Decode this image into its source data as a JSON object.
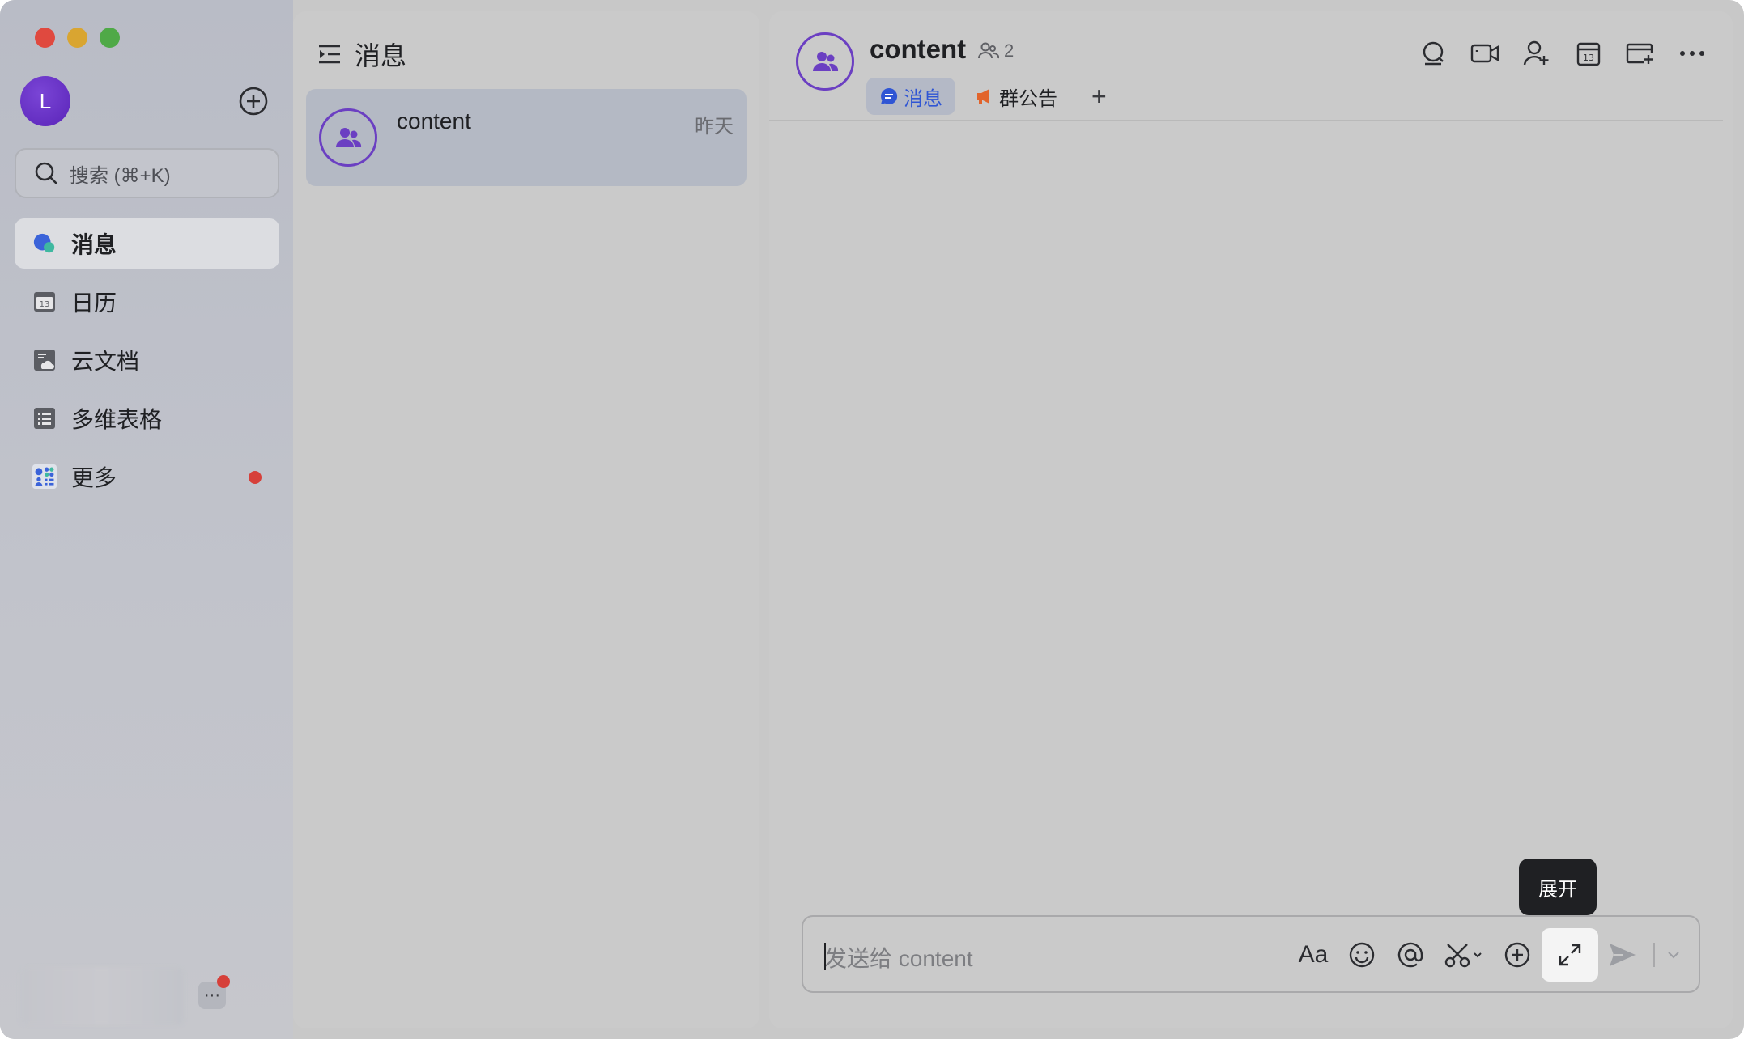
{
  "sidebar": {
    "avatar_initial": "L",
    "search_placeholder": "搜索 (⌘+K)",
    "items": [
      {
        "label": "消息",
        "active": true
      },
      {
        "label": "日历"
      },
      {
        "label": "云文档"
      },
      {
        "label": "多维表格"
      },
      {
        "label": "更多",
        "badge": true
      }
    ],
    "more_button_label": "···"
  },
  "list_panel": {
    "title": "消息",
    "chats": [
      {
        "name": "content",
        "time": "昨天"
      }
    ]
  },
  "chat": {
    "title": "content",
    "member_count": "2",
    "tabs": [
      {
        "label": "消息",
        "active": true
      },
      {
        "label": "群公告"
      }
    ],
    "tab_add": "+",
    "input_placeholder": "发送给 content",
    "tooltip": "展开",
    "format_label": "Aa"
  },
  "colors": {
    "accent_purple": "#6b3fc2",
    "active_tab_text": "#2f55d4",
    "badge_red": "#d6403a",
    "announcement_orange": "#e2642b"
  }
}
